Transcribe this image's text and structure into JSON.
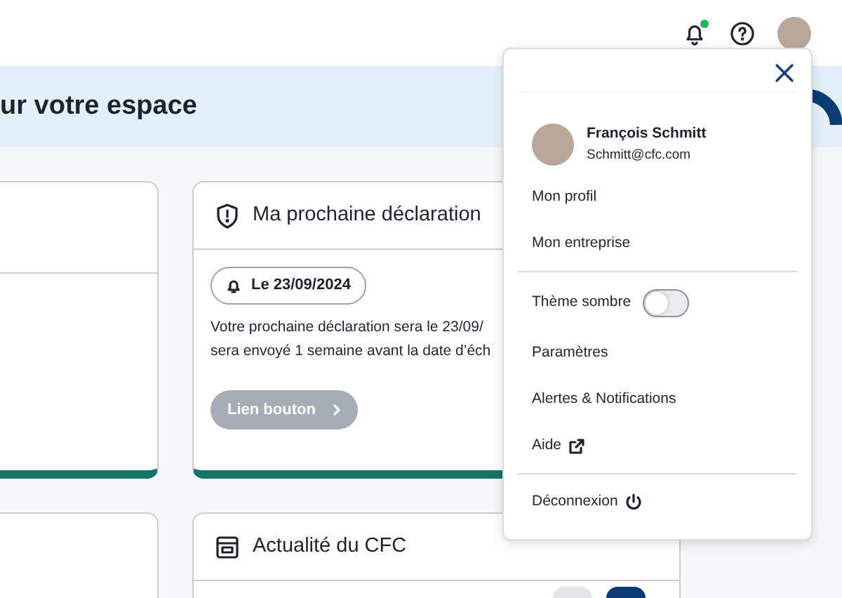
{
  "topbar": {
    "notification_dot": true
  },
  "banner": {
    "title": "ur votre espace"
  },
  "declaration_card": {
    "title": "Ma prochaine déclaration",
    "date_badge": "Le 23/09/2024",
    "text_lines": [
      "Votre prochaine déclaration sera le 23/09/",
      "sera envoyé 1 semaine avant la date d’éch"
    ],
    "button": {
      "label": "Lien bouton",
      "disabled": true
    }
  },
  "news_card": {
    "title": "Actualité du CFC"
  },
  "user_menu": {
    "name": "François Schmitt",
    "email": "Schmitt@cfc.com",
    "items": [
      {
        "kind": "link",
        "label": "Mon profil"
      },
      {
        "kind": "link",
        "label": "Mon entreprise"
      },
      {
        "kind": "divider"
      },
      {
        "kind": "toggle",
        "label": "Thème sombre",
        "checked": false
      },
      {
        "kind": "link",
        "label": "Paramètres"
      },
      {
        "kind": "link",
        "label": "Alertes & Notifications"
      },
      {
        "kind": "external",
        "label": "Aide"
      },
      {
        "kind": "divider"
      },
      {
        "kind": "logout",
        "label": "Déconnexion"
      }
    ]
  }
}
